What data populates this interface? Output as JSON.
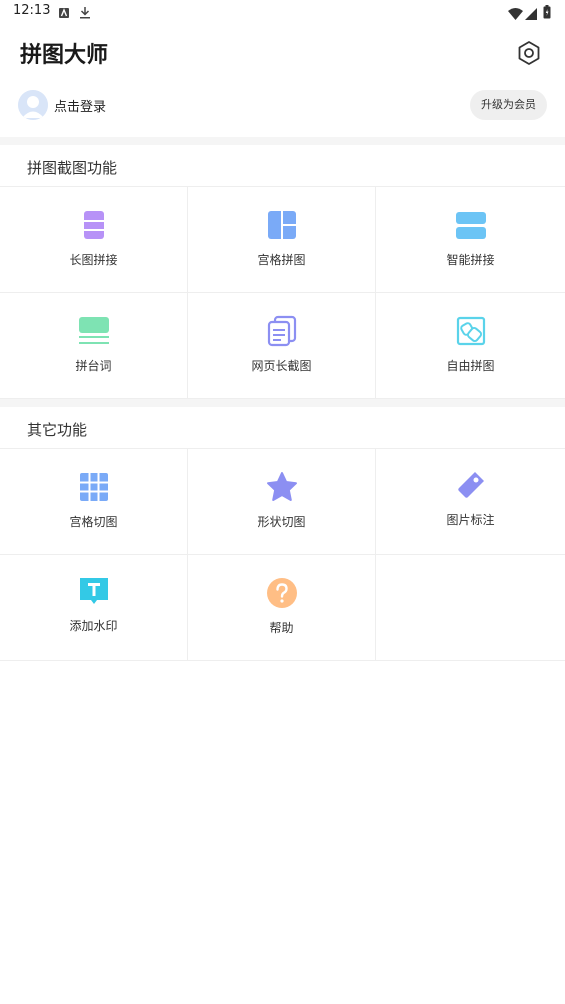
{
  "status_bar": {
    "time": "12:13"
  },
  "header": {
    "title": "拼图大师"
  },
  "user": {
    "login_label": "点击登录",
    "vip_button": "升级为会员"
  },
  "sections": [
    {
      "title": "拼图截图功能",
      "items": [
        {
          "label": "长图拼接",
          "icon": "long-image-icon"
        },
        {
          "label": "宫格拼图",
          "icon": "grid-collage-icon"
        },
        {
          "label": "智能拼接",
          "icon": "smart-stitch-icon"
        },
        {
          "label": "拼台词",
          "icon": "subtitle-stitch-icon"
        },
        {
          "label": "网页长截图",
          "icon": "webpage-screenshot-icon"
        },
        {
          "label": "自由拼图",
          "icon": "free-collage-icon"
        }
      ]
    },
    {
      "title": "其它功能",
      "items": [
        {
          "label": "宫格切图",
          "icon": "grid-cut-icon"
        },
        {
          "label": "形状切图",
          "icon": "shape-cut-icon"
        },
        {
          "label": "图片标注",
          "icon": "image-tag-icon"
        },
        {
          "label": "添加水印",
          "icon": "watermark-icon"
        },
        {
          "label": "帮助",
          "icon": "help-icon"
        }
      ]
    }
  ],
  "colors": {
    "purple": "#b792f7",
    "blue": "#7aaaf7",
    "sky": "#6cc4f5",
    "green": "#7ee3b3",
    "indigo": "#8c8ff2",
    "cyan": "#5ad3ea",
    "orange": "#ffbe85",
    "teal": "#33c9e6"
  }
}
